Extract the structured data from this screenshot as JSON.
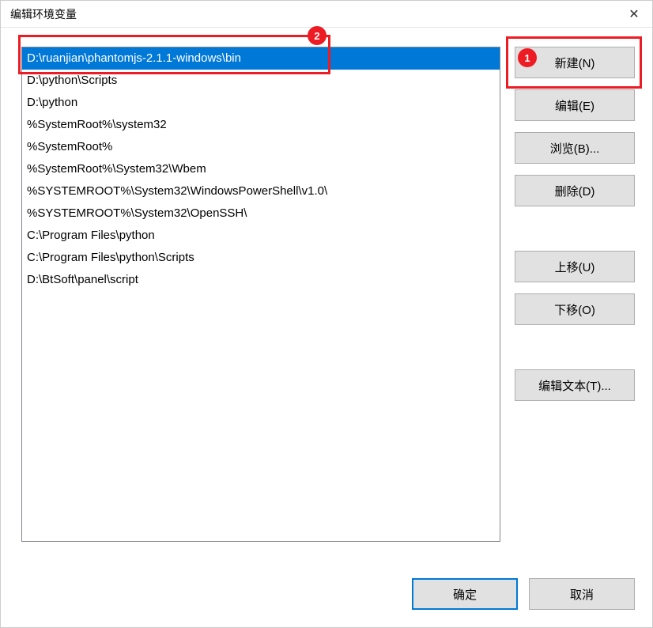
{
  "titlebar": {
    "title": "编辑环境变量"
  },
  "list": {
    "items": [
      "D:\\ruanjian\\phantomjs-2.1.1-windows\\bin",
      "D:\\python\\Scripts",
      "D:\\python",
      "%SystemRoot%\\system32",
      "%SystemRoot%",
      "%SystemRoot%\\System32\\Wbem",
      "%SYSTEMROOT%\\System32\\WindowsPowerShell\\v1.0\\",
      "%SYSTEMROOT%\\System32\\OpenSSH\\",
      "C:\\Program Files\\python",
      "C:\\Program Files\\python\\Scripts",
      "D:\\BtSoft\\panel\\script"
    ],
    "selected_index": 0
  },
  "buttons": {
    "new": "新建(N)",
    "edit": "编辑(E)",
    "browse": "浏览(B)...",
    "delete": "删除(D)",
    "move_up": "上移(U)",
    "move_down": "下移(O)",
    "edit_text": "编辑文本(T)...",
    "ok": "确定",
    "cancel": "取消"
  },
  "annotations": {
    "callout1": "1",
    "callout2": "2"
  }
}
